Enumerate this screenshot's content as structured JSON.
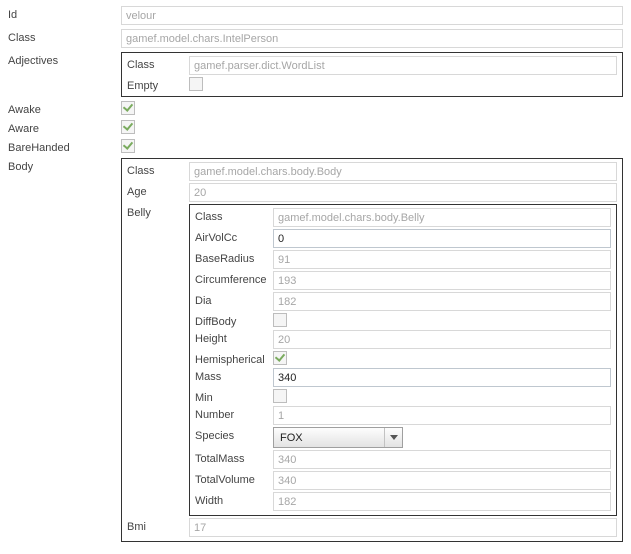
{
  "id": {
    "label": "Id",
    "value": "velour"
  },
  "class": {
    "label": "Class",
    "value": "gamef.model.chars.IntelPerson"
  },
  "adjectives": {
    "label": "Adjectives",
    "class": {
      "label": "Class",
      "value": "gamef.parser.dict.WordList"
    },
    "empty": {
      "label": "Empty",
      "checked": false
    }
  },
  "awake": {
    "label": "Awake",
    "checked": true
  },
  "aware": {
    "label": "Aware",
    "checked": true
  },
  "barehanded": {
    "label": "BareHanded",
    "checked": true
  },
  "body": {
    "label": "Body",
    "class": {
      "label": "Class",
      "value": "gamef.model.chars.body.Body"
    },
    "age": {
      "label": "Age",
      "value": "20"
    },
    "belly": {
      "label": "Belly",
      "class": {
        "label": "Class",
        "value": "gamef.model.chars.body.Belly"
      },
      "airvolcc": {
        "label": "AirVolCc",
        "value": "0"
      },
      "baseradius": {
        "label": "BaseRadius",
        "value": "91"
      },
      "circumference": {
        "label": "Circumference",
        "value": "193"
      },
      "dia": {
        "label": "Dia",
        "value": "182"
      },
      "diffbody": {
        "label": "DiffBody",
        "checked": false
      },
      "height": {
        "label": "Height",
        "value": "20"
      },
      "hemispherical": {
        "label": "Hemispherical",
        "checked": true
      },
      "mass": {
        "label": "Mass",
        "value": "340"
      },
      "min": {
        "label": "Min",
        "checked": false
      },
      "number": {
        "label": "Number",
        "value": "1"
      },
      "species": {
        "label": "Species",
        "value": "FOX"
      },
      "totalmass": {
        "label": "TotalMass",
        "value": "340"
      },
      "totalvolume": {
        "label": "TotalVolume",
        "value": "340"
      },
      "width": {
        "label": "Width",
        "value": "182"
      }
    },
    "bmi": {
      "label": "Bmi",
      "value": "17"
    }
  }
}
